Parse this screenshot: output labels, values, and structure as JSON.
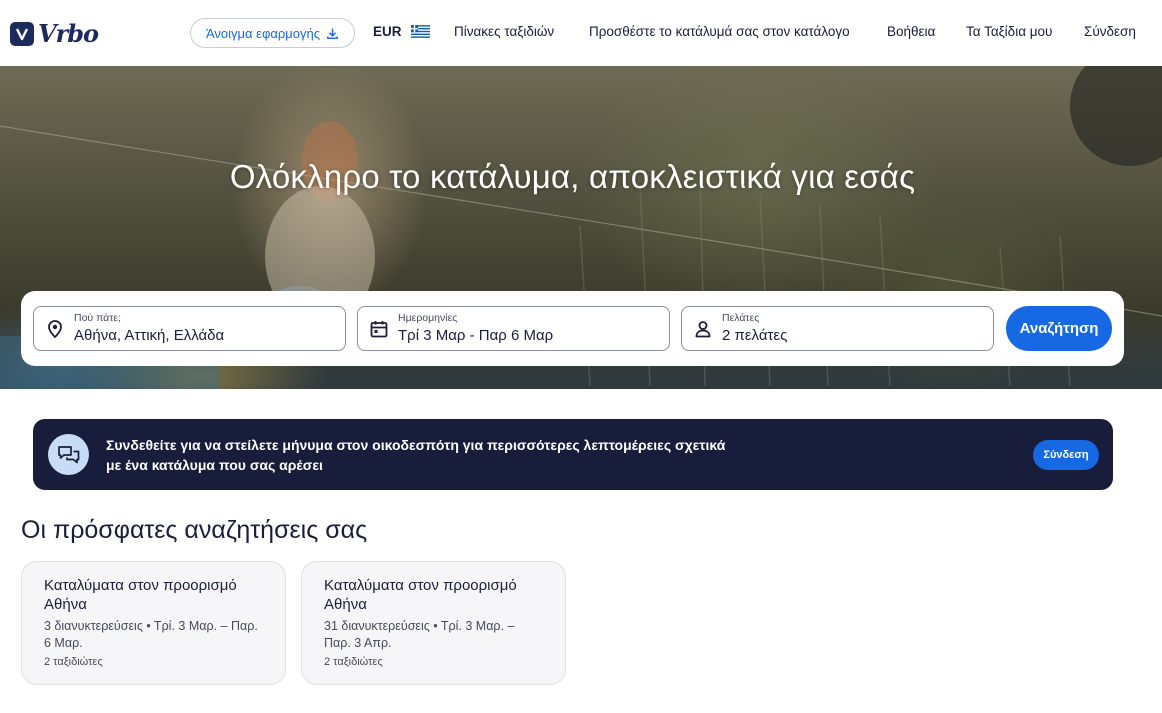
{
  "header": {
    "logo_text": "Vrbo",
    "app_button_label": "Άνοιγμα εφαρμογής",
    "currency": "EUR",
    "nav": {
      "trip_boards": "Πίνακες ταξιδιών",
      "list_property": "Προσθέστε το κατάλυμά σας στον κατάλογο",
      "help": "Βοήθεια",
      "my_trips": "Τα Ταξίδια μου",
      "sign_in": "Σύνδεση"
    }
  },
  "hero": {
    "title": "Ολόκληρο το κατάλυμα, αποκλειστικά για εσάς"
  },
  "search": {
    "destination": {
      "label": "Πού πάτε;",
      "value": "Αθήνα, Αττική, Ελλάδα",
      "icon": "map-pin-icon"
    },
    "dates": {
      "label": "Ημερομηνίες",
      "value": "Τρί 3 Μαρ - Παρ 6 Μαρ",
      "icon": "calendar-icon"
    },
    "guests": {
      "label": "Πελάτες",
      "value": "2 πελάτες",
      "icon": "person-icon"
    },
    "button_label": "Αναζήτηση"
  },
  "banner": {
    "text_line1": "Συνδεθείτε για να στείλετε μήνυμα στον οικοδεσπότη για περισσότερες λεπτομέρειες σχετικά",
    "text_line2": "με ένα κατάλυμα που σας αρέσει",
    "button_label": "Σύνδεση",
    "icon": "chat-bubbles-icon"
  },
  "recent": {
    "title": "Οι πρόσφατες αναζητήσεις σας",
    "cards": [
      {
        "title": "Καταλύματα στον προορισμό Αθήνα",
        "details": "3 διανυκτερεύσεις • Τρί. 3 Μαρ. – Παρ. 6 Μαρ.",
        "travelers": "2 ταξιδιώτες"
      },
      {
        "title": "Καταλύματα στον προορισμό Αθήνα",
        "details": "31 διανυκτερεύσεις • Τρί. 3 Μαρ. – Παρ. 3 Απρ.",
        "travelers": "2 ταξιδιώτες"
      }
    ]
  },
  "colors": {
    "brand_navy": "#1c2a5e",
    "primary_blue": "#1668e3",
    "banner_bg": "#171d3b",
    "text": "#191e3b"
  }
}
